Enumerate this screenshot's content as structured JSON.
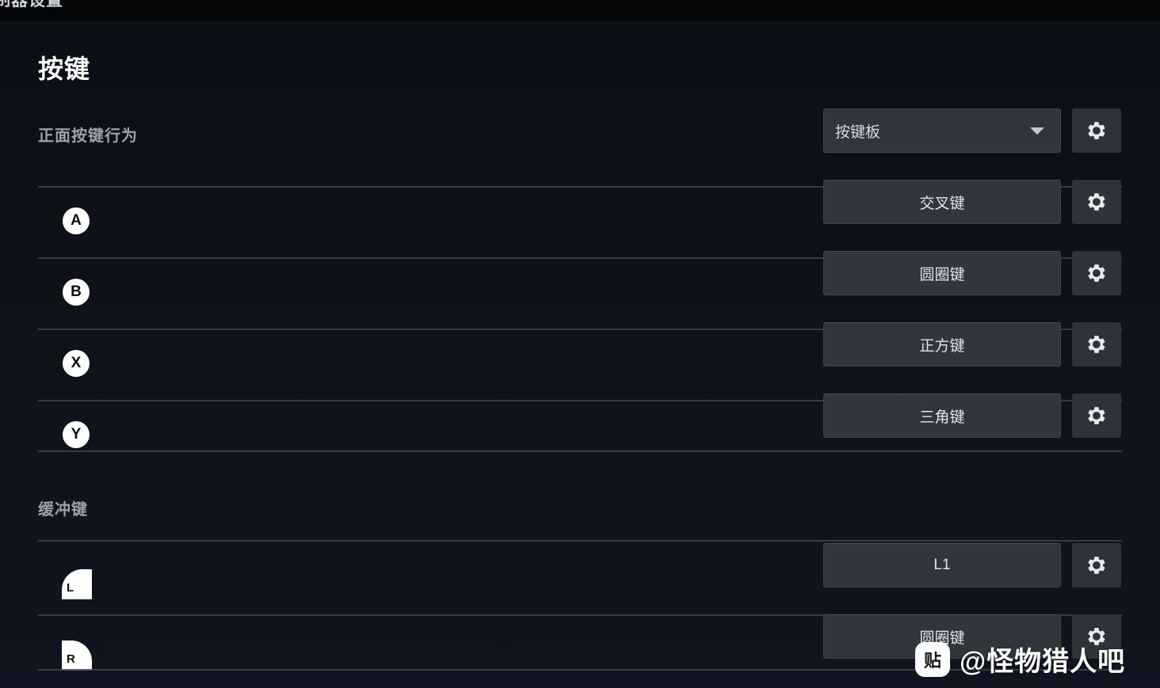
{
  "window": {
    "header_title_clipped": "制器设置"
  },
  "page": {
    "title": "按键"
  },
  "sections": [
    {
      "label": "正面按键行为",
      "dropdown": {
        "value": "按键板",
        "gear": "gear-icon"
      },
      "rows": [
        {
          "glyph": "A",
          "glyph_type": "circle",
          "value": "交叉键"
        },
        {
          "glyph": "B",
          "glyph_type": "circle",
          "value": "圆圈键"
        },
        {
          "glyph": "X",
          "glyph_type": "circle",
          "value": "正方键"
        },
        {
          "glyph": "Y",
          "glyph_type": "circle",
          "value": "三角键"
        }
      ]
    },
    {
      "label": "缓冲键",
      "rows": [
        {
          "glyph": "L",
          "glyph_type": "bumper-left",
          "value": "L1"
        },
        {
          "glyph": "R",
          "glyph_type": "bumper-right",
          "value": "圆圈键"
        }
      ]
    }
  ],
  "watermark": {
    "badge": "贴",
    "text": "@怪物猎人吧"
  },
  "colors": {
    "background": "#0d1117",
    "button_fill": "#31353c",
    "gear_fill": "#2e333a",
    "divider": "#3d4450",
    "label_text": "#9aa2ae",
    "value_text": "#e3e7ec",
    "title_text": "#ffffff",
    "glyph_fill": "#ffffff"
  }
}
